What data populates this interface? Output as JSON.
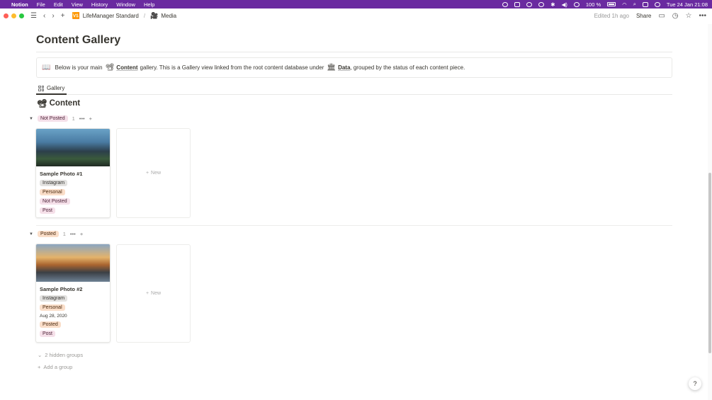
{
  "menubar": {
    "apple": "",
    "items": [
      "Notion",
      "File",
      "Edit",
      "View",
      "History",
      "Window",
      "Help"
    ],
    "battery": "100 %",
    "clock": "Tue 24 Jan  21:08"
  },
  "topbar": {
    "breadcrumb": [
      {
        "emoji": "🆚",
        "label": "LifeManager Standard"
      },
      {
        "emoji": "🎥",
        "label": "Media"
      }
    ],
    "breadcrumb_sep": "/",
    "edited": "Edited 1h ago",
    "share": "Share"
  },
  "page": {
    "title": "Content Gallery",
    "callout": {
      "emoji": "📖",
      "text_1": "Below is your main",
      "link_1_emoji": "📽",
      "link_1": "Content",
      "text_2": "gallery. This is a Gallery view linked from the root content database under",
      "link_2_emoji": "🏛",
      "link_2": "Data",
      "text_3": ", grouped by the status of each content piece."
    },
    "tab": "Gallery",
    "database": {
      "emoji": "📽",
      "title": "Content"
    }
  },
  "groups": [
    {
      "label": "Not Posted",
      "count": "1",
      "color": "#f5e0e9",
      "card": {
        "name": "Sample Photo #1",
        "tags": [
          "Instagram",
          "Personal",
          "Not Posted",
          "Post"
        ]
      },
      "new_label": "New"
    },
    {
      "label": "Posted",
      "count": "1",
      "color": "#fadec9",
      "card": {
        "name": "Sample Photo #2",
        "tags": [
          "Instagram",
          "Personal"
        ],
        "date": "Aug 28, 2020",
        "tags_after": [
          "Posted",
          "Post"
        ]
      },
      "new_label": "New"
    }
  ],
  "footer": {
    "hidden_groups": "2 hidden groups",
    "add_group": "Add a group"
  },
  "help": "?"
}
